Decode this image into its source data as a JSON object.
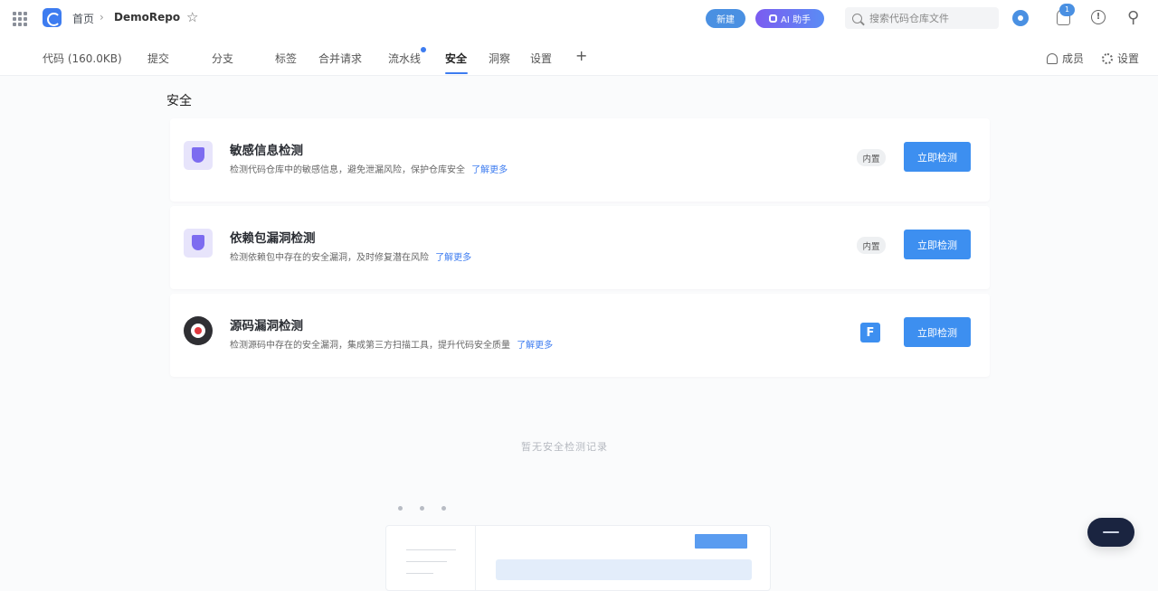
{
  "header": {
    "breadcrumb_home": "首页",
    "breadcrumb_sep": "›",
    "repo_name": "DemoRepo",
    "pill_button": "新建",
    "ai_button": "AI 助手",
    "search_placeholder": "搜索代码仓库文件"
  },
  "notifications": {
    "count": "1"
  },
  "tabs": [
    {
      "label": "代码 (160.0KB)"
    },
    {
      "label": "提交"
    },
    {
      "label": "分支"
    },
    {
      "label": "标签"
    },
    {
      "label": "合并请求"
    },
    {
      "label": "流水线"
    },
    {
      "label": "安全"
    },
    {
      "label": "洞察"
    },
    {
      "label": "设置"
    }
  ],
  "tab_right": {
    "members": "成员",
    "settings": "设置"
  },
  "page_title": "安全",
  "cards": [
    {
      "title": "敏感信息检测",
      "desc": "检测代码仓库中的敏感信息，避免泄漏风险，保护仓库安全",
      "learn": "了解更多",
      "tag": "内置",
      "button": "立即检测"
    },
    {
      "title": "依赖包漏洞检测",
      "desc": "检测依赖包中存在的安全漏洞，及时修复潜在风险",
      "learn": "了解更多",
      "tag": "内置",
      "button": "立即检测"
    },
    {
      "title": "源码漏洞检测",
      "desc": "检测源码中存在的安全漏洞，集成第三方扫描工具，提升代码安全质量",
      "learn": "了解更多",
      "tag_icon": "F",
      "button": "立即检测"
    }
  ],
  "empty_state": {
    "text": "暂无安全检测记录"
  },
  "colors": {
    "accent": "#3d8ff0",
    "purple": "#7d6cf0",
    "dark": "#1a2440"
  }
}
